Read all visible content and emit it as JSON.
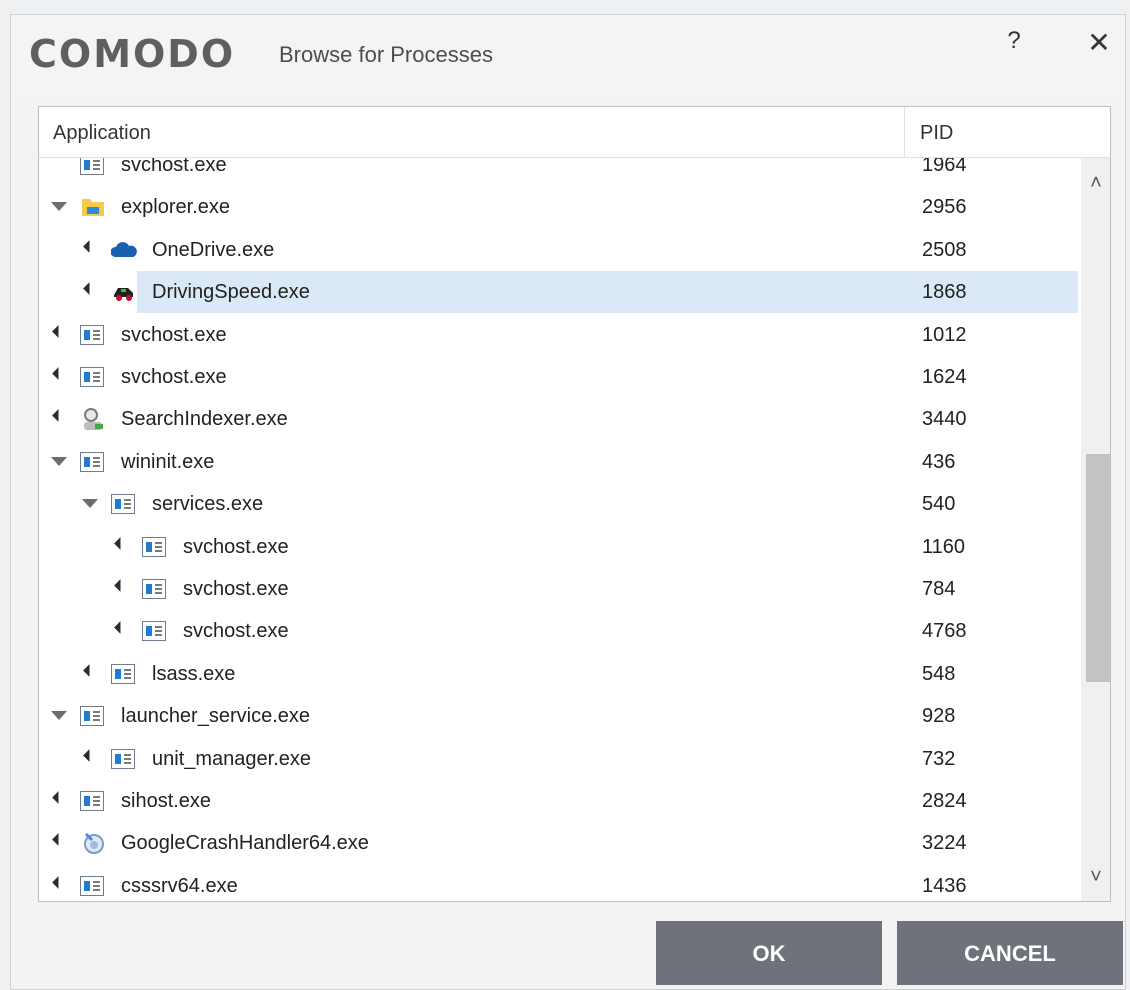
{
  "dialog": {
    "brand": "COMODO",
    "title": "Browse for Processes",
    "help_label": "?",
    "close_label": "✕"
  },
  "table": {
    "columns": [
      "Application",
      "PID"
    ],
    "rows": [
      {
        "name": "svchost.exe",
        "pid": "1964",
        "icon": "window-process-icon",
        "expander": "none",
        "level": 0
      },
      {
        "name": "explorer.exe",
        "pid": "2956",
        "icon": "folder-icon",
        "expander": "expanded",
        "level": 0
      },
      {
        "name": "OneDrive.exe",
        "pid": "2508",
        "icon": "onedrive-cloud-icon",
        "expander": "collapsed",
        "level": 1
      },
      {
        "name": "DrivingSpeed.exe",
        "pid": "1868",
        "icon": "car-icon",
        "expander": "collapsed",
        "level": 1,
        "selected": true
      },
      {
        "name": "svchost.exe",
        "pid": "1012",
        "icon": "window-process-icon",
        "expander": "collapsed",
        "level": 0
      },
      {
        "name": "svchost.exe",
        "pid": "1624",
        "icon": "window-process-icon",
        "expander": "collapsed",
        "level": 0
      },
      {
        "name": "SearchIndexer.exe",
        "pid": "3440",
        "icon": "search-indexer-icon",
        "expander": "collapsed",
        "level": 0
      },
      {
        "name": "wininit.exe",
        "pid": "436",
        "icon": "window-process-icon",
        "expander": "expanded",
        "level": 0
      },
      {
        "name": "services.exe",
        "pid": "540",
        "icon": "window-process-icon",
        "expander": "expanded",
        "level": 1
      },
      {
        "name": "svchost.exe",
        "pid": "1160",
        "icon": "window-process-icon",
        "expander": "collapsed",
        "level": 2
      },
      {
        "name": "svchost.exe",
        "pid": "784",
        "icon": "window-process-icon",
        "expander": "collapsed",
        "level": 2
      },
      {
        "name": "svchost.exe",
        "pid": "4768",
        "icon": "window-process-icon",
        "expander": "collapsed",
        "level": 2
      },
      {
        "name": "lsass.exe",
        "pid": "548",
        "icon": "window-process-icon",
        "expander": "collapsed",
        "level": 1
      },
      {
        "name": "launcher_service.exe",
        "pid": "928",
        "icon": "window-process-icon",
        "expander": "expanded",
        "level": 0
      },
      {
        "name": "unit_manager.exe",
        "pid": "732",
        "icon": "window-process-icon",
        "expander": "collapsed",
        "level": 1
      },
      {
        "name": "sihost.exe",
        "pid": "2824",
        "icon": "window-process-icon",
        "expander": "collapsed",
        "level": 0
      },
      {
        "name": "GoogleCrashHandler64.exe",
        "pid": "3224",
        "icon": "google-crash-handler-icon",
        "expander": "collapsed",
        "level": 0
      },
      {
        "name": "csssrv64.exe",
        "pid": "1436",
        "icon": "window-process-icon",
        "expander": "collapsed",
        "level": 0
      }
    ]
  },
  "buttons": {
    "ok": "OK",
    "cancel": "CANCEL"
  },
  "scrollbar": {
    "up": "˄",
    "down": "˅"
  },
  "colors": {
    "selection": "#dbe8f5",
    "button": "#6f727a",
    "brand": "#5f5f5f"
  }
}
